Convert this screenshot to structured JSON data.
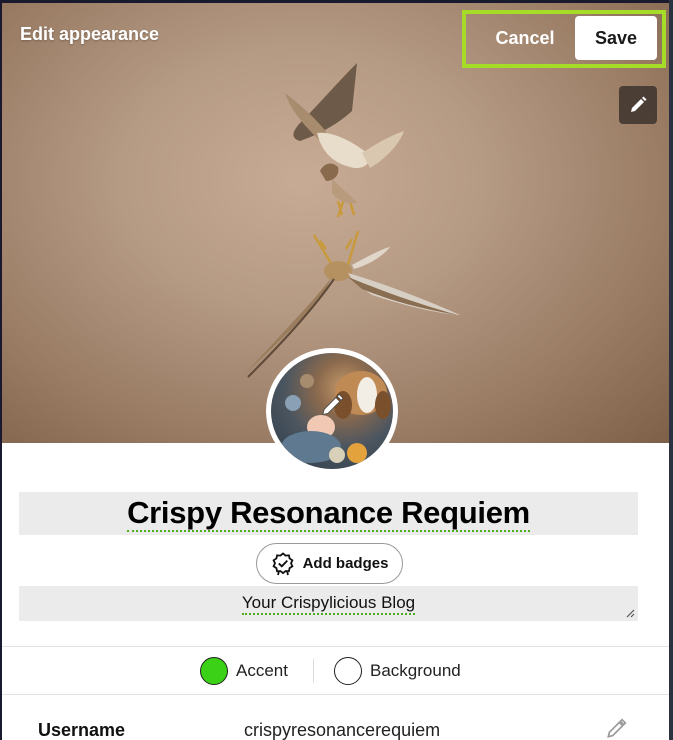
{
  "header": {
    "title": "Edit appearance",
    "cancel_label": "Cancel",
    "save_label": "Save",
    "highlight_color": "#a4dc28",
    "edit_icon": "pencil-icon"
  },
  "avatar": {
    "edit_icon": "pencil-icon"
  },
  "profile": {
    "blog_name": "Crispy Resonance Requiem",
    "badges_label": "Add badges",
    "badges_icon": "badge-check-icon",
    "description": "Your Crispylicious Blog"
  },
  "colors": {
    "accent_label": "Accent",
    "accent_color": "#3bd116",
    "background_label": "Background",
    "background_color": "#ffffff"
  },
  "settings": {
    "username_label": "Username",
    "username_value": "crispyresonancerequiem",
    "edit_icon": "pencil-icon"
  }
}
